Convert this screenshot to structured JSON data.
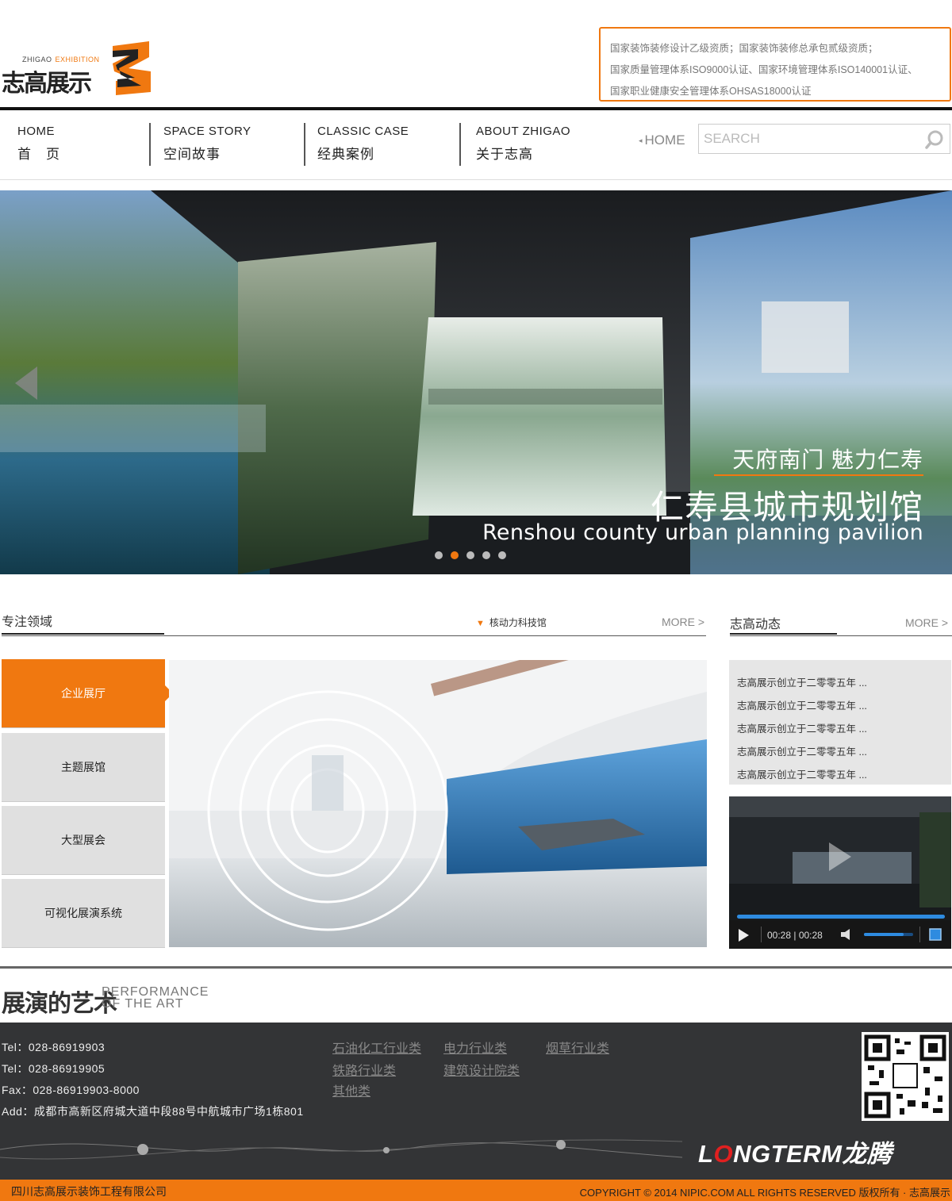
{
  "header": {
    "logo_sub_en": "ZHIGAO",
    "logo_sub_ex": "EXHIBITION",
    "logo_main": "志高展示",
    "qualifications": [
      "国家装饰装修设计乙级资质；国家装饰装修总承包贰级资质；",
      "国家质量管理体系ISO9000认证、国家环境管理体系ISO140001认证、",
      "国家职业健康安全管理体系OHSAS18000认证"
    ]
  },
  "nav": {
    "items": [
      {
        "en": "HOME",
        "cn": "首　页"
      },
      {
        "en": "SPACE STORY",
        "cn": "空间故事"
      },
      {
        "en": "CLASSIC CASE",
        "cn": "经典案例"
      },
      {
        "en": "ABOUT ZHIGAO",
        "cn": "关于志高"
      }
    ],
    "home_link": "HOME",
    "search_placeholder": "SEARCH"
  },
  "hero": {
    "caption_line1": "天府南门  魅力仁寿",
    "caption_line2": "仁寿县城市规划馆",
    "caption_line3": "Renshou county urban planning pavilion",
    "slides_total": 5,
    "slide_active": 2
  },
  "focus": {
    "title": "专注领域",
    "tag": "核动力科技馆",
    "more": "MORE >",
    "categories": [
      "企业展厅",
      "主题展馆",
      "大型展会",
      "可视化展演系统"
    ],
    "active_category": 0
  },
  "news": {
    "title": "志高动态",
    "more": "MORE >",
    "items": [
      "志高展示创立于二零零五年 ...",
      "志高展示创立于二零零五年 ...",
      "志高展示创立于二零零五年 ...",
      "志高展示创立于二零零五年 ...",
      "志高展示创立于二零零五年 ..."
    ]
  },
  "video": {
    "time": "00:28 | 00:28",
    "progress": 1.0,
    "volume": 0.8
  },
  "performance": {
    "cn": "展演的艺术",
    "en_line1": "PERFORMANCE",
    "en_line2": "OF THE ART"
  },
  "footer": {
    "contact": [
      "Tel：028-86919903",
      "Tel：028-86919905",
      "Fax：028-86919903-8000",
      "Add：成都市高新区府城大道中段88号中航城市广场1栋801"
    ],
    "links": [
      "石油化工行业类",
      "电力行业类",
      "烟草行业类",
      "铁路行业类",
      "建筑设计院类",
      "其他类"
    ],
    "brand_l": "L",
    "brand_o": "O",
    "brand_rest": "NGTERM",
    "brand_cn": "龙腾",
    "company": "四川志高展示装饰工程有限公司",
    "copyright": "COPYRIGHT © 2014 NIPIC.COM ALL RIGHTS RESERVED   版权所有 · 志高展示"
  },
  "colors": {
    "accent": "#f07810",
    "footer_bg": "#333436",
    "tab_bg": "#e0e0e0"
  }
}
